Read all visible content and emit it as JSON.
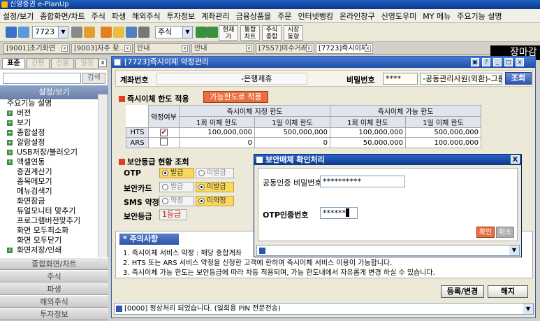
{
  "window": {
    "title": "신영증권 e-PlanUp"
  },
  "menu": [
    "설정/보기",
    "종합화면/차트",
    "주식",
    "파생",
    "해외주식",
    "투자정보",
    "계좌관리",
    "금융상품몰",
    "주문",
    "인터넷뱅킹",
    "온라인창구",
    "신영도우미",
    "MY 메뉴",
    "주요기능 설명"
  ],
  "toolbar": {
    "code": "7723",
    "category": "주식",
    "btn1": [
      "현재",
      "가"
    ],
    "btn2": [
      "통합",
      "차트"
    ],
    "btn3": [
      "주식",
      "종합"
    ],
    "btn4": [
      "시장",
      "동향"
    ]
  },
  "tabs": [
    "[9001]초기화면",
    "[9003]자주 찾..",
    "안내",
    "안내",
    "[7557]미수거래..",
    "[7723]즉시이체.."
  ],
  "banner": "장마감",
  "sidebar": {
    "tabs": [
      "표준",
      "간편",
      "선물",
      "일정"
    ],
    "search_btn": "검색",
    "group": "설정/보기",
    "items": [
      "주요기능 설명",
      "버전",
      "보기",
      "종합설정",
      "알람설정",
      "USB저장/불러오기",
      "액셀연동",
      "증권계산기",
      "종목메모기",
      "메뉴검색기",
      "화면잠금",
      "듀얼모니터 맞추기",
      "프로그램버전맞추기",
      "화면 모두최소화",
      "화면 모두닫기",
      "화면저장/인쇄"
    ],
    "bottom": [
      "종합화면/차트",
      "주식",
      "파생",
      "해외주식",
      "투자정보"
    ]
  },
  "main": {
    "title": "[7723]즉시이체 약정관리",
    "account": {
      "label": "계좌번호",
      "value": "-은행제휴",
      "pw_label": "비밀번호",
      "pw": "****",
      "name": "-공동관리사원(외환)-그룹",
      "search": "조회"
    },
    "limit": {
      "title": "즉시이체 한도 적용",
      "apply_btn": "가능한도로 적용",
      "col_yn": "약정여부",
      "col_set": "즉시이체 지정 한도",
      "col_avail": "즉시이체 가능 한도",
      "col_once": "1회 이체 한도",
      "col_day": "1일 이체 한도",
      "rows": [
        {
          "name": "HTS",
          "check": "✔",
          "set_once": "100,000,000",
          "set_day": "500,000,000",
          "av_once": "100,000,000",
          "av_day": "500,000,000"
        },
        {
          "name": "ARS",
          "check": "",
          "set_once": "0",
          "set_day": "0",
          "av_once": "50,000,000",
          "av_day": "100,000,000"
        }
      ]
    },
    "security": {
      "title": "보안등급 현황 조회",
      "otp": "OTP",
      "card": "보안카드",
      "sms": "SMS 약정",
      "grade_label": "보안등급",
      "grade": "1등급",
      "issued": "발급",
      "not_issued": "미발급",
      "agreed": "약정",
      "not_agreed": "미약정"
    },
    "notes": {
      "title": "주의사항",
      "lines": [
        "1. 즉시이체 서비스 약정 : 해당 종합계좌",
        "2. HTS 또는 ARS 서비스 약정을 신청한 고객에 한하여 즉시이체 서비스 이용이 가능합니다.",
        "3. 즉시이체 가능 한도는 보안등급에 따라 차등 적용되며, 가능 한도내에서 자유롭게 변경 하실 수 있습니다."
      ]
    },
    "register_btn": "등록/변경",
    "close_btn": "해지",
    "status": "[0000] 정상처리 되었습니다. (일회용 PIN 전문전송)"
  },
  "dialog": {
    "title": "보안매체 확인처리",
    "cert_label": "공동인증 비밀번호",
    "cert_value": "**********",
    "otp_label": "OTP인증번호",
    "otp_value": "******",
    "ok": "확인",
    "cancel": "취소"
  },
  "colors": {
    "accent": "#f8d860",
    "title_blue": "#1e4fa8",
    "danger": "#e04020"
  }
}
